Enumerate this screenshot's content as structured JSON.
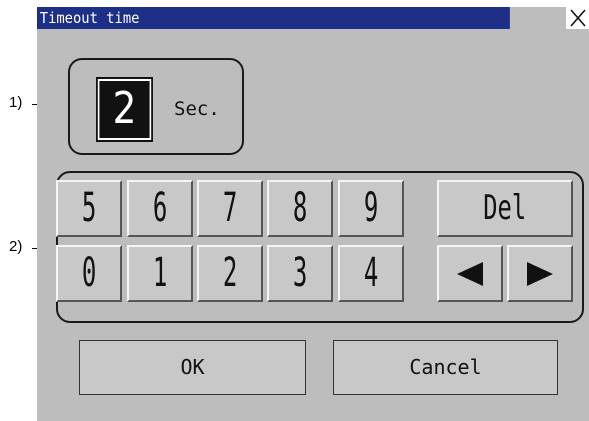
{
  "callouts": [
    "1)",
    "2)"
  ],
  "dialog": {
    "title": "Timeout time",
    "close_icon": "close-x-icon"
  },
  "timeout": {
    "value": "2",
    "unit": "Sec."
  },
  "keypad": {
    "row1": [
      "5",
      "6",
      "7",
      "8",
      "9"
    ],
    "row2": [
      "0",
      "1",
      "2",
      "3",
      "4"
    ],
    "delete_label": "Del",
    "left_arrow_icon": "left-arrow-icon",
    "right_arrow_icon": "right-arrow-icon"
  },
  "buttons": {
    "ok_label": "OK",
    "cancel_label": "Cancel"
  },
  "colors": {
    "titlebar": "#1d2f86",
    "dialog_background": "#bdbdbd",
    "value_background": "#111111"
  }
}
